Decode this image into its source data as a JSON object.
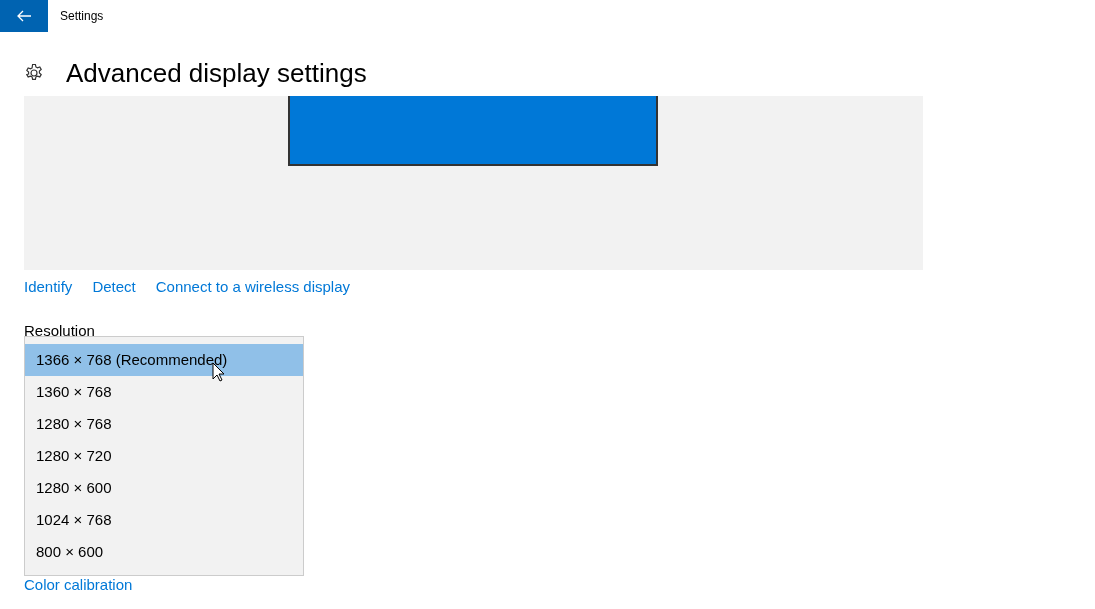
{
  "window": {
    "title": "Settings"
  },
  "page_title": "Advanced display settings",
  "links": [
    "Identify",
    "Detect",
    "Connect to a wireless display"
  ],
  "resolution": {
    "label": "Resolution",
    "options": [
      {
        "label": "1366 × 768 (Recommended)",
        "selected": true
      },
      {
        "label": "1360 × 768",
        "selected": false
      },
      {
        "label": "1280 × 768",
        "selected": false
      },
      {
        "label": "1280 × 720",
        "selected": false
      },
      {
        "label": "1280 × 600",
        "selected": false
      },
      {
        "label": "1024 × 768",
        "selected": false
      },
      {
        "label": "800 × 600",
        "selected": false
      }
    ]
  },
  "bottom_link": "Color calibration"
}
